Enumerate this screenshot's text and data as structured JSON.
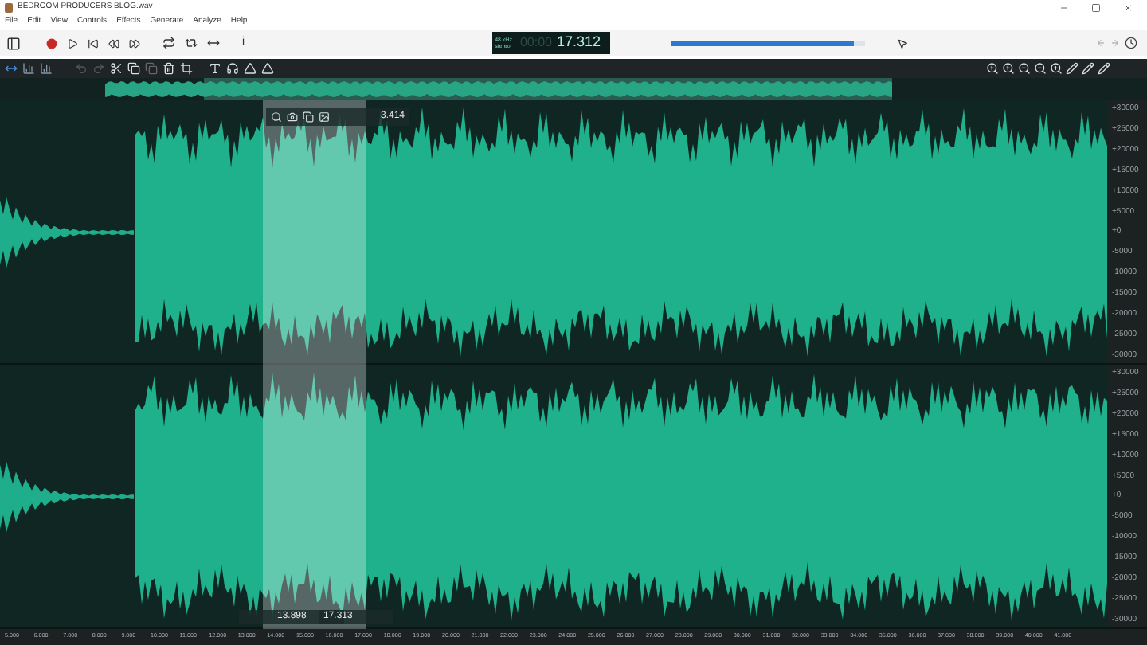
{
  "window": {
    "title": "BEDROOM PRODUCERS BLOG.wav"
  },
  "menu": [
    "File",
    "Edit",
    "View",
    "Controls",
    "Effects",
    "Generate",
    "Analyze",
    "Help"
  ],
  "info_text": "i",
  "time_display": {
    "rate": "48 kHz",
    "channels": "stereo",
    "dim_digits": "00:00",
    "time": "17.312"
  },
  "volume": {
    "level": 0.95
  },
  "selection": {
    "length": "3.414",
    "start": "13.898",
    "end": "17.313"
  },
  "channels": [
    {
      "amplitude_ruler": [
        "+30000",
        "+25000",
        "+20000",
        "+15000",
        "+10000",
        "+5000",
        "+0",
        "-5000",
        "-10000",
        "-15000",
        "-20000",
        "-25000",
        "-30000"
      ]
    },
    {
      "amplitude_ruler": [
        "+30000",
        "+25000",
        "+20000",
        "+15000",
        "+10000",
        "+5000",
        "+0",
        "-5000",
        "-10000",
        "-15000",
        "-20000",
        "-25000",
        "-30000"
      ]
    }
  ],
  "time_ruler": [
    "5.000",
    "6.000",
    "7.000",
    "8.000",
    "9.000",
    "10.000",
    "11.000",
    "12.000",
    "13.000",
    "14.000",
    "15.000",
    "16.000",
    "17.000",
    "18.000",
    "19.000",
    "20.000",
    "21.000",
    "22.000",
    "23.000",
    "24.000",
    "25.000",
    "26.000",
    "27.000",
    "28.000",
    "29.000",
    "30.000",
    "31.000",
    "32.000",
    "33.000",
    "34.000",
    "35.000",
    "36.000",
    "37.000",
    "38.000",
    "39.000",
    "40.000",
    "41.000"
  ]
}
